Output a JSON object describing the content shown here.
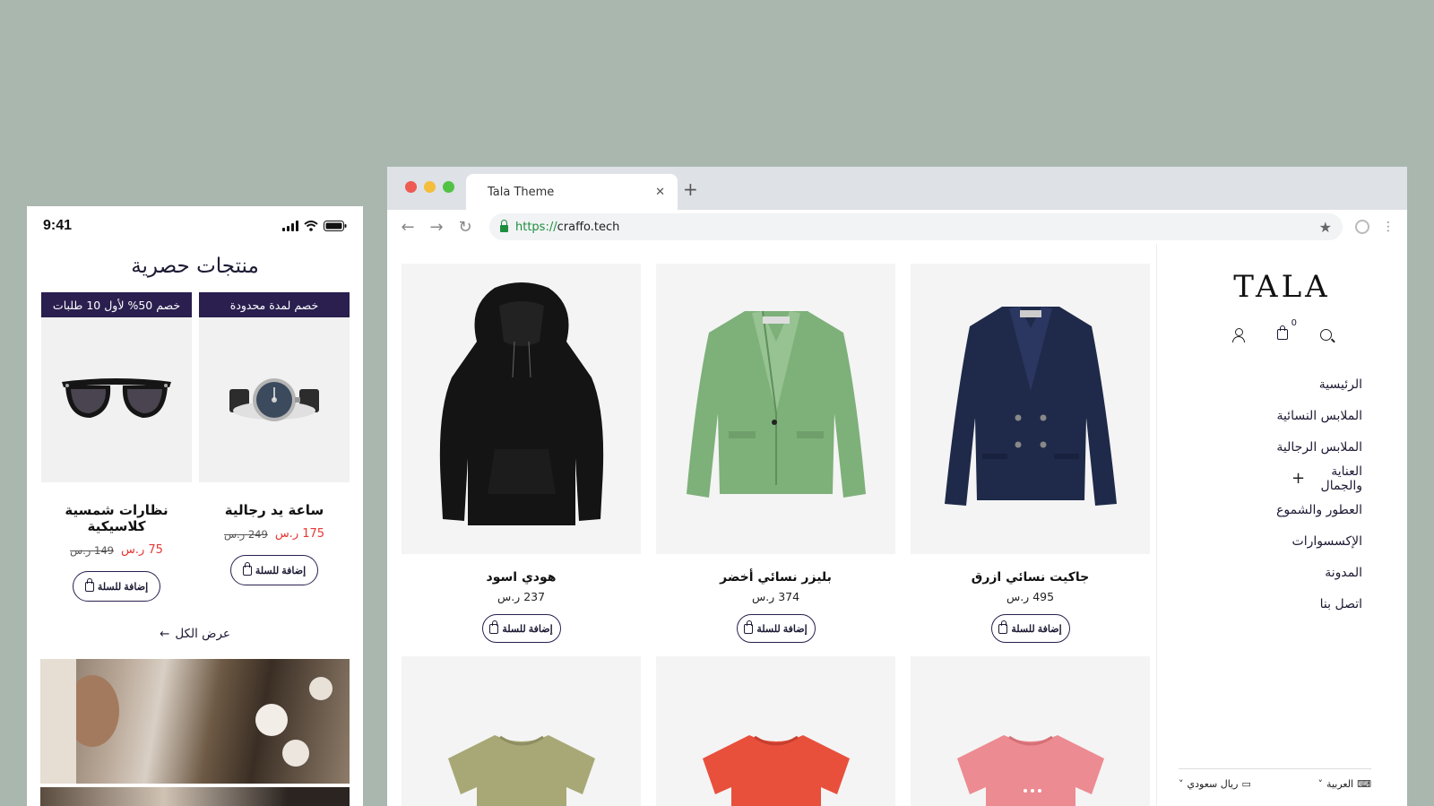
{
  "phone": {
    "time": "9:41",
    "title": "منتجات حصرية",
    "cards": [
      {
        "banner": "خصم لمدة محدودة",
        "name": "ساعة يد رجالية",
        "price_new": "175 ر.س",
        "price_old": "249 ر.س",
        "cta": "إضافة للسلة",
        "image": "wristwatch"
      },
      {
        "banner": "خصم 50% لأول 10 طلبات",
        "name": "نظارات شمسية كلاسيكية",
        "price_new": "75 ر.س",
        "price_old": "149 ر.س",
        "cta": "إضافة للسلة",
        "image": "sunglasses"
      }
    ],
    "view_all": "عرض الكل"
  },
  "browser": {
    "tab_title": "Tala Theme",
    "url_scheme": "https://",
    "url_host": "craffo.tech",
    "traffic_colors": [
      "#ee5b53",
      "#f5bd3c",
      "#52c245"
    ]
  },
  "store": {
    "logo": "TALA",
    "cart_count": "0",
    "nav": [
      {
        "label": "الرئيسية"
      },
      {
        "label": "الملابس النسائية"
      },
      {
        "label": "الملابس الرجالية"
      },
      {
        "label": "العناية والجمال"
      },
      {
        "label": "العطور والشموع"
      },
      {
        "label": "الإكسسوارات"
      },
      {
        "label": "المدونة"
      },
      {
        "label": "اتصل بنا"
      }
    ],
    "currency": "ريال سعودي",
    "language": "العربية",
    "products": [
      {
        "name": "هودي اسود",
        "price": "237 ر.س",
        "cta": "إضافة للسلة",
        "color": "#141414"
      },
      {
        "name": "بليزر نسائي أخضر",
        "price": "374 ر.س",
        "cta": "إضافة للسلة",
        "color": "#7eb07a"
      },
      {
        "name": "جاكيت نسائي ازرق",
        "price": "495 ر.س",
        "cta": "إضافة للسلة",
        "color": "#1f2a4a"
      }
    ],
    "tshirts": [
      {
        "color": "#a8a877"
      },
      {
        "color": "#e8503c"
      },
      {
        "color": "#ec8b91"
      }
    ]
  }
}
